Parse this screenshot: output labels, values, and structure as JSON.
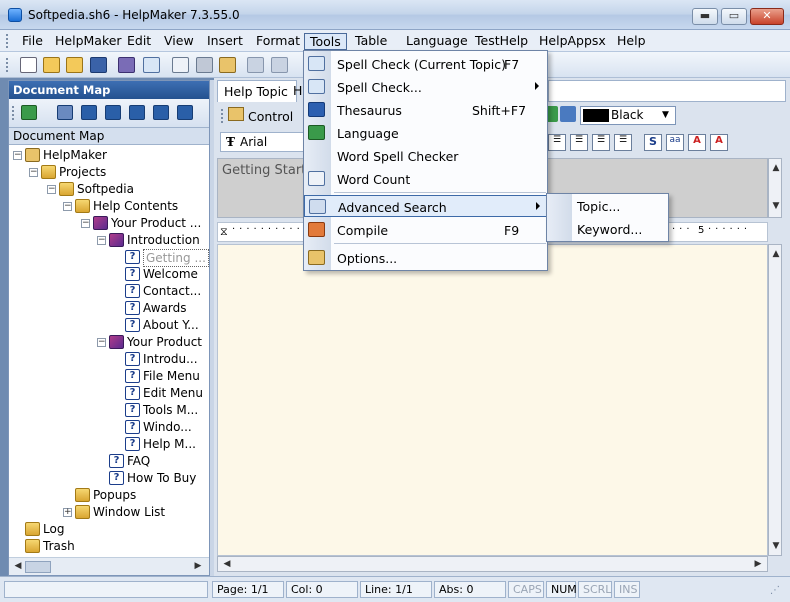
{
  "window": {
    "title": "Softpedia.sh6 - HelpMaker 7.3.55.0",
    "minimize": "▬",
    "maximize": "▭",
    "close": "✕"
  },
  "menubar": [
    "File",
    "HelpMaker",
    "Edit",
    "View",
    "Insert",
    "Format",
    "Tools",
    "Table",
    "Language",
    "TestHelp",
    "HelpAppsx",
    "Help"
  ],
  "left_pane": {
    "header": "Document Map",
    "tab": "Document Map",
    "tree": [
      {
        "label": "HelpMaker",
        "level": 0,
        "expander": "−",
        "icon": "house"
      },
      {
        "label": "Projects",
        "level": 1,
        "expander": "−",
        "icon": "folder"
      },
      {
        "label": "Softpedia",
        "level": 2,
        "expander": "−",
        "icon": "folder"
      },
      {
        "label": "Help Contents",
        "level": 3,
        "expander": "−",
        "icon": "folder"
      },
      {
        "label": "Your Product ...",
        "level": 4,
        "expander": "−",
        "icon": "book"
      },
      {
        "label": "Introduction",
        "level": 5,
        "expander": "−",
        "icon": "book"
      },
      {
        "label": "Getting ...",
        "level": 6,
        "expander": "",
        "icon": "help",
        "selected": true
      },
      {
        "label": "Welcome",
        "level": 6,
        "expander": "",
        "icon": "help"
      },
      {
        "label": "Contact...",
        "level": 6,
        "expander": "",
        "icon": "help"
      },
      {
        "label": "Awards",
        "level": 6,
        "expander": "",
        "icon": "help"
      },
      {
        "label": "About Y...",
        "level": 6,
        "expander": "",
        "icon": "help"
      },
      {
        "label": "Your Product",
        "level": 5,
        "expander": "−",
        "icon": "book"
      },
      {
        "label": "Introdu...",
        "level": 6,
        "expander": "",
        "icon": "help"
      },
      {
        "label": "File Menu",
        "level": 6,
        "expander": "",
        "icon": "help"
      },
      {
        "label": "Edit Menu",
        "level": 6,
        "expander": "",
        "icon": "help"
      },
      {
        "label": "Tools M...",
        "level": 6,
        "expander": "",
        "icon": "help"
      },
      {
        "label": "Windo...",
        "level": 6,
        "expander": "",
        "icon": "help"
      },
      {
        "label": "Help M...",
        "level": 6,
        "expander": "",
        "icon": "help"
      },
      {
        "label": "FAQ",
        "level": 5,
        "expander": "",
        "icon": "help"
      },
      {
        "label": "How To Buy",
        "level": 5,
        "expander": "",
        "icon": "help"
      },
      {
        "label": "Popups",
        "level": 3,
        "expander": "",
        "icon": "folder"
      },
      {
        "label": "Window List",
        "level": 3,
        "expander": "+",
        "icon": "folder"
      },
      {
        "label": "Log",
        "level": 0,
        "expander": "",
        "icon": "folder"
      },
      {
        "label": "Trash",
        "level": 0,
        "expander": "",
        "icon": "folder"
      }
    ]
  },
  "editor": {
    "tab_help_topic": "Help Topic",
    "tab_h": "H",
    "control_label": "Control",
    "font_name": "Arial",
    "color_name": "Black",
    "topic_title": "Getting Starte",
    "ruler_number": "5"
  },
  "tools_menu": {
    "items": [
      {
        "label": "Spell Check (Current Topic)",
        "shortcut": "F7",
        "submenu": false,
        "icon": "spell-check-icon"
      },
      {
        "label": "Spell Check...",
        "shortcut": "",
        "submenu": true,
        "icon": "spell-check-dots-icon"
      },
      {
        "label": "Thesaurus",
        "shortcut": "Shift+F7",
        "submenu": false,
        "icon": "thesaurus-icon"
      },
      {
        "label": "Language",
        "shortcut": "",
        "submenu": false,
        "icon": "language-icon"
      },
      {
        "label": "Word Spell Checker",
        "shortcut": "",
        "submenu": false,
        "icon": ""
      },
      {
        "label": "Word Count",
        "shortcut": "",
        "submenu": false,
        "icon": "word-count-icon"
      },
      {
        "label": "Advanced Search",
        "shortcut": "",
        "submenu": true,
        "icon": "advanced-search-icon",
        "highlighted": true
      },
      {
        "label": "Compile",
        "shortcut": "F9",
        "submenu": false,
        "icon": "compile-icon"
      },
      {
        "label": "Options...",
        "shortcut": "",
        "submenu": false,
        "icon": "options-icon"
      }
    ]
  },
  "advanced_search_submenu": [
    "Topic...",
    "Keyword..."
  ],
  "statusbar": {
    "page": "Page: 1/1",
    "col": "Col: 0",
    "line": "Line: 1/1",
    "abs": "Abs: 0",
    "caps": "CAPS",
    "num": "NUM",
    "scrl": "SCRL",
    "ins": "INS"
  }
}
